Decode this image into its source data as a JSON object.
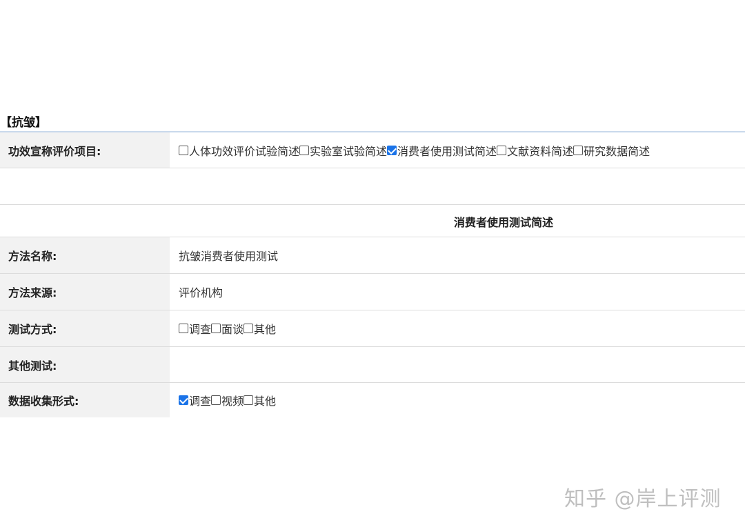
{
  "section": {
    "title": "【抗皱】"
  },
  "claim_row": {
    "label": "功效宣称评价项目:",
    "options": [
      {
        "label": "人体功效评价试验简述",
        "checked": false
      },
      {
        "label": "实验室试验简述",
        "checked": false
      },
      {
        "label": "消费者使用测试简述",
        "checked": true
      },
      {
        "label": "文献资料简述",
        "checked": false
      },
      {
        "label": "研究数据简述",
        "checked": false
      }
    ]
  },
  "subheading": "消费者使用测试简述",
  "fields": {
    "method_name": {
      "label": "方法名称:",
      "value": "抗皱消费者使用测试"
    },
    "method_source": {
      "label": "方法来源:",
      "value": "评价机构"
    },
    "test_method": {
      "label": "测试方式:",
      "options": [
        {
          "label": "调查",
          "checked": false
        },
        {
          "label": "面谈",
          "checked": false
        },
        {
          "label": "其他",
          "checked": false
        }
      ]
    },
    "other_test": {
      "label": "其他测试:",
      "value": ""
    },
    "data_collection": {
      "label": "数据收集形式:",
      "options": [
        {
          "label": "调查",
          "checked": true
        },
        {
          "label": "视频",
          "checked": false
        },
        {
          "label": "其他",
          "checked": false
        }
      ]
    }
  },
  "watermark": "知乎 @岸上评测",
  "colors": {
    "label_bg": "#f2f2f2",
    "checkbox_checked": "#1a73e8",
    "divider": "#dcdcdc",
    "top_line": "#c9d9ec"
  }
}
